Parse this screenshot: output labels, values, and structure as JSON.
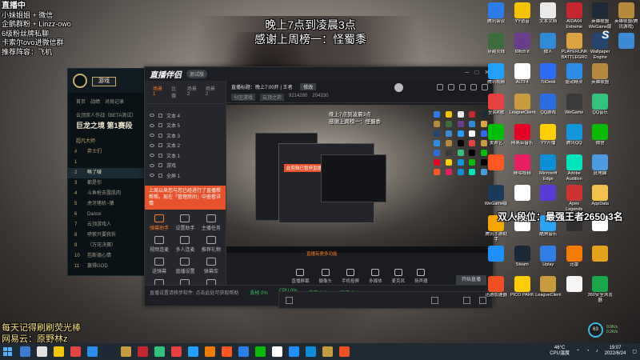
{
  "overlays": {
    "top_left_lines": [
      "直播中",
      "小妹姐姐 + 微信",
      "企鹅群粉 + Linzz-owo",
      "6级粉丝牌私聊",
      "卡索尔ovo进微信群",
      "推荐阵容：飞机"
    ],
    "announcement": [
      "晚上7点到凌晨3点",
      "感谢上周榜一：怪蜀黍"
    ],
    "rank": "双人段位：最强王者2650 3名",
    "bottom_left_lines": [
      "每天记得刷刷荧光棒",
      "网易云：原野林z"
    ]
  },
  "lol_client": {
    "play_label": "游戏",
    "tabs": [
      "首页",
      "战绩",
      "对局记录"
    ],
    "mode": "云顶双人作战（BETA测试）",
    "title": "巨龙之境 第1赛段",
    "section": "超凡大师",
    "list_header": [
      "#",
      "弈士们"
    ],
    "rows": [
      {
        "n": "1",
        "name": ""
      },
      {
        "n": "2",
        "name": "咻了啵",
        "highlight": true
      },
      {
        "n": "3",
        "name": "都是你"
      },
      {
        "n": "4",
        "name": "斗鱼枪去露肌肉"
      },
      {
        "n": "5",
        "name": "虎牙猪机~猿"
      },
      {
        "n": "6",
        "name": "Dance"
      },
      {
        "n": "7",
        "name": "云顶游戏人"
      },
      {
        "n": "8",
        "name": "喷紫只要我拆"
      },
      {
        "n": "9",
        "name": "（万花决赛）"
      },
      {
        "n": "10",
        "name": "芭斯德心情"
      },
      {
        "n": "11",
        "name": "赢得GOD"
      }
    ]
  },
  "stream_app": {
    "brand": "直播伴侣",
    "version": "测试版",
    "scene_tabs": [
      "场景1",
      "比赛",
      "场景2",
      "场景2"
    ],
    "sources": [
      "文本 4",
      "文本 5",
      "文本 3",
      "文本 2",
      "文本 1",
      "游戏",
      "全屏 1"
    ],
    "notice": "上周以来您与您已经进行了直播帮帮帮。现在「管理房间」中查看详情",
    "tools": [
      {
        "label": "弹幕助手",
        "orange": true
      },
      {
        "label": "设置助手",
        "orange": false
      },
      {
        "label": "主播任务",
        "orange": false
      },
      {
        "label": "视频连麦",
        "orange": false
      },
      {
        "label": "多人连麦",
        "orange": false
      },
      {
        "label": "推荐礼物",
        "orange": false
      },
      {
        "label": "送弹幕",
        "orange": false
      },
      {
        "label": "直播设置",
        "orange": false
      },
      {
        "label": "弹幕库",
        "orange": false
      },
      {
        "label": "",
        "orange": false
      },
      {
        "label": "",
        "orange": false
      },
      {
        "label": "",
        "orange": false
      }
    ],
    "room_title": "直播标题：晚上7:00开 | 王者",
    "room_btn": "修改",
    "room_tags": [
      "分区游戏",
      "云顶之弈"
    ],
    "room_meta_values": [
      "9214280",
      "204330"
    ],
    "preview_text": [
      "晚上7点到凌晨3点",
      "感谢上周榜一：怪蜀黍"
    ],
    "preview_notice": "此剪辑已暂停直播",
    "live_plus": "直播有更多功能",
    "controls": [
      "直播屏幕",
      "摄像头",
      "手机投屏",
      "多媒体",
      "麦克风",
      "扬声器"
    ],
    "live_btn": "开始直播",
    "status": [
      "直播设置请移步软件: 点击此处可获取帮助",
      "丢帧 0%",
      "CPU 0%",
      "内存 24%",
      "码率 0kb/s"
    ]
  },
  "desktop": {
    "icons": [
      {
        "label": "腾讯会议",
        "color": "#2b7de9"
      },
      {
        "label": "YY语音",
        "color": "#f5c400"
      },
      {
        "label": "文本文档",
        "color": "#e9e9e9"
      },
      {
        "label": "AIDA64 Extreme",
        "color": "#c6262e"
      },
      {
        "label": "英雄联盟WeGame版",
        "color": "#1e2a38"
      },
      {
        "label": "英雄联盟(腾讯游戏)",
        "color": "#b58a3c"
      },
      {
        "label": "穿越火线",
        "color": "#3a6d3a"
      },
      {
        "label": "Witch it",
        "color": "#6a3d8c"
      },
      {
        "label": "微人",
        "color": "#2f8bd7"
      },
      {
        "label": "PLAYERUNKNOWN'S BATTLEGROUNDS",
        "color": "#d9a441"
      },
      {
        "label": "Wallpaper Engine",
        "color": "#26456e"
      },
      {
        "label": "",
        "color": "#3a8ad6"
      },
      {
        "label": "腾讯视频",
        "color": "#21a0ff"
      },
      {
        "label": "ALTF4",
        "color": "#ffffff"
      },
      {
        "label": "ToDesk",
        "color": "#2e6cf6"
      },
      {
        "label": "驱动精灵",
        "color": "#2c8de8"
      },
      {
        "label": "英雄联盟",
        "color": "#b58a3c"
      },
      {
        "label": "",
        "color": "#000000"
      },
      {
        "label": "全民K歌",
        "color": "#e64040"
      },
      {
        "label": "LeagueClient",
        "color": "#c89b3c"
      },
      {
        "label": "QQ游戏",
        "color": "#2a6ee0"
      },
      {
        "label": "WeGame",
        "color": "#3a3a3a"
      },
      {
        "label": "QQ音乐",
        "color": "#31c27c"
      },
      {
        "label": "",
        "color": "#000000"
      },
      {
        "label": "爱奇艺",
        "color": "#00be06"
      },
      {
        "label": "网易云音乐",
        "color": "#e60026"
      },
      {
        "label": "YY开播",
        "color": "#ffd000"
      },
      {
        "label": "腾讯QQ",
        "color": "#1296db"
      },
      {
        "label": "微信",
        "color": "#09bb07"
      },
      {
        "label": "",
        "color": "#000000"
      },
      {
        "label": "",
        "color": "#ff5722"
      },
      {
        "label": "咪咕视频",
        "color": "#e91e63"
      },
      {
        "label": "Microsoft Edge",
        "color": "#0c8ed9"
      },
      {
        "label": "Adobe Audition",
        "color": "#00e4bb"
      },
      {
        "label": "此电脑",
        "color": "#4a9be0"
      },
      {
        "label": "",
        "color": "#000000"
      },
      {
        "label": "WeGame版",
        "color": "#1b3b5a"
      },
      {
        "label": "",
        "color": "#ffffff"
      },
      {
        "label": "",
        "color": "#5a3ad6"
      },
      {
        "label": "Apex Legends",
        "color": "#cd3333"
      },
      {
        "label": "AppData",
        "color": "#f2c14e"
      },
      {
        "label": "",
        "color": "#000000"
      },
      {
        "label": "腾讯手游助手",
        "color": "#f7a600"
      },
      {
        "label": "",
        "color": "#ffffff"
      },
      {
        "label": "酷狗音乐",
        "color": "#2ca2f5"
      },
      {
        "label": "",
        "color": "#2f2f2f"
      },
      {
        "label": "",
        "color": "#ffffff"
      },
      {
        "label": "",
        "color": "#000000"
      },
      {
        "label": "",
        "color": "#1e90ff"
      },
      {
        "label": "Steam",
        "color": "#1b2838"
      },
      {
        "label": "Uplay",
        "color": "#2f7ee8"
      },
      {
        "label": "迅雷",
        "color": "#f57a00"
      },
      {
        "label": "",
        "color": "#e4a11b"
      },
      {
        "label": "",
        "color": "#000000"
      },
      {
        "label": "迅游加速器",
        "color": "#f25022"
      },
      {
        "label": "PICO PARK",
        "color": "#ffcc00"
      },
      {
        "label": "LeagueClient",
        "color": "#c89b3c"
      },
      {
        "label": "",
        "color": "#f5f5f5"
      },
      {
        "label": "360安全浏览器",
        "color": "#18a74b"
      },
      {
        "label": "",
        "color": "#000000"
      }
    ],
    "speed_value": "63",
    "speed_lines": [
      "0.0K/s",
      "0.2K/s"
    ]
  },
  "taskbar": {
    "apps": [
      "#3c7bd1",
      "#e1e1e1",
      "#f5c400",
      "#e84343",
      "#2d8cf0",
      "#1b2838",
      "#c89b3c",
      "#c6262e",
      "#31c27c",
      "#e64040",
      "#21a0ff",
      "#f57a00",
      "#ff5722",
      "#2b7de9",
      "#09bb07",
      "#ffffff",
      "#1e90ff",
      "#0c8ed9",
      "#c89b3c",
      "#f25022"
    ],
    "weather": [
      "46°C",
      "CPU温度"
    ],
    "clock": [
      "19:07",
      "2022/6/24"
    ]
  }
}
